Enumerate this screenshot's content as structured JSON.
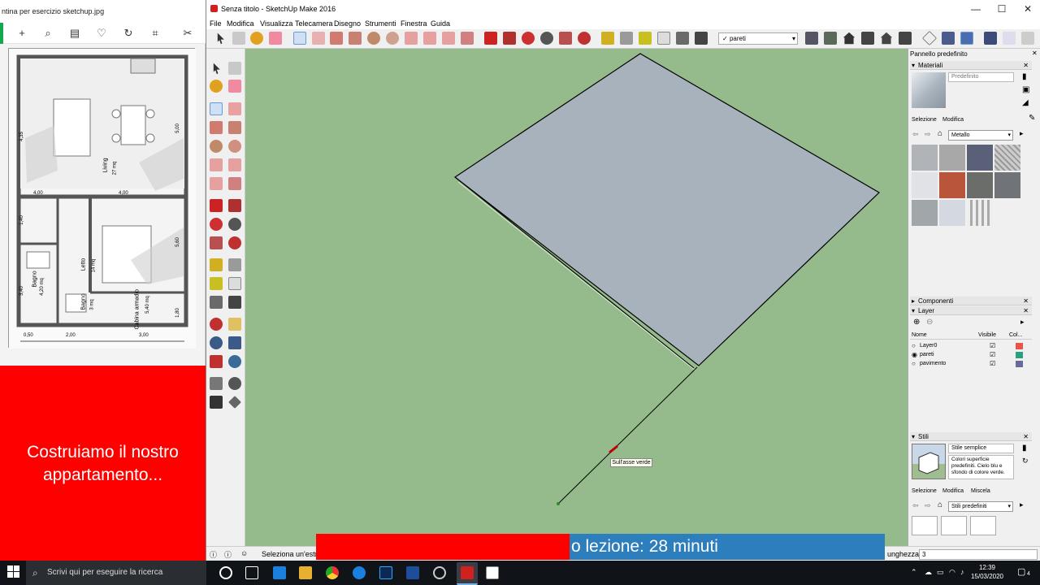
{
  "viewer": {
    "title": "ntina per esercizio sketchup.jpg",
    "plan_labels": {
      "living": "Living",
      "living_area": "27 mq",
      "letto": "Letto",
      "letto_area": "14 mq",
      "bagno1": "Bagno",
      "bagno1_area": "4,20 mq",
      "bagno2": "Bagno",
      "bagno2_area": "3 mq",
      "cabina": "Cabina armadio",
      "cabina_area": "5,40 mq",
      "dim_1": "4,00",
      "dim_2": "4,00",
      "dim_3": "2,00",
      "dim_4": "3,00",
      "dim_5": "0,50",
      "dim_6": "5,00",
      "dim_7": "4,35",
      "dim_8": "3,40",
      "dim_9": "1,80",
      "dim_10": "1,40",
      "dim_11": "5,60"
    }
  },
  "overlay": {
    "red_text_line1": "Costruiamo il nostro",
    "red_text_line2": "appartamento...",
    "lesson_text": "o lezione: 28 minuti"
  },
  "sketchup": {
    "title": "Senza titolo - SketchUp Make 2016",
    "menu": [
      "File",
      "Modifica",
      "Visualizza",
      "Telecamera",
      "Disegno",
      "Strumenti",
      "Finestra",
      "Guida"
    ],
    "layer_select": "pareti",
    "tooltip": "Sull'asse verde",
    "status_text": "Seleziona un'estre",
    "vcb_label": "unghezza",
    "vcb_value": "3"
  },
  "tray": {
    "title": "Pannello predefinito",
    "materials": {
      "header": "Materiali",
      "name": "Predefinito",
      "tab_select": "Selezione",
      "tab_edit": "Modifica",
      "library": "Metallo"
    },
    "components_header": "Componenti",
    "layers": {
      "header": "Layer",
      "col_name": "Nome",
      "col_visible": "Visibile",
      "col_color": "Col...",
      "rows": [
        {
          "name": "Layer0",
          "active": false,
          "visible": true,
          "color": "#e8534a"
        },
        {
          "name": "pareti",
          "active": true,
          "visible": true,
          "color": "#2aa080"
        },
        {
          "name": "pavimento",
          "active": false,
          "visible": true,
          "color": "#6a6a9a"
        }
      ]
    },
    "styles": {
      "header": "Stili",
      "name": "Stile semplice",
      "description": "Colori superficie predefiniti. Cielo blu e sfondo di colore verde.",
      "tab_select": "Selezione",
      "tab_edit": "Modifica",
      "tab_mix": "Miscela",
      "library": "Stili predefiniti"
    }
  },
  "taskbar": {
    "search_placeholder": "Scrivi qui per eseguire la ricerca",
    "time": "12:39",
    "date": "15/03/2020",
    "notifications": "4"
  },
  "colors": {
    "viewport_green": "#95ba8b",
    "face_grey": "#a8b2bc",
    "overlay_red": "#ff0000",
    "overlay_blue": "#2d7ebd"
  }
}
